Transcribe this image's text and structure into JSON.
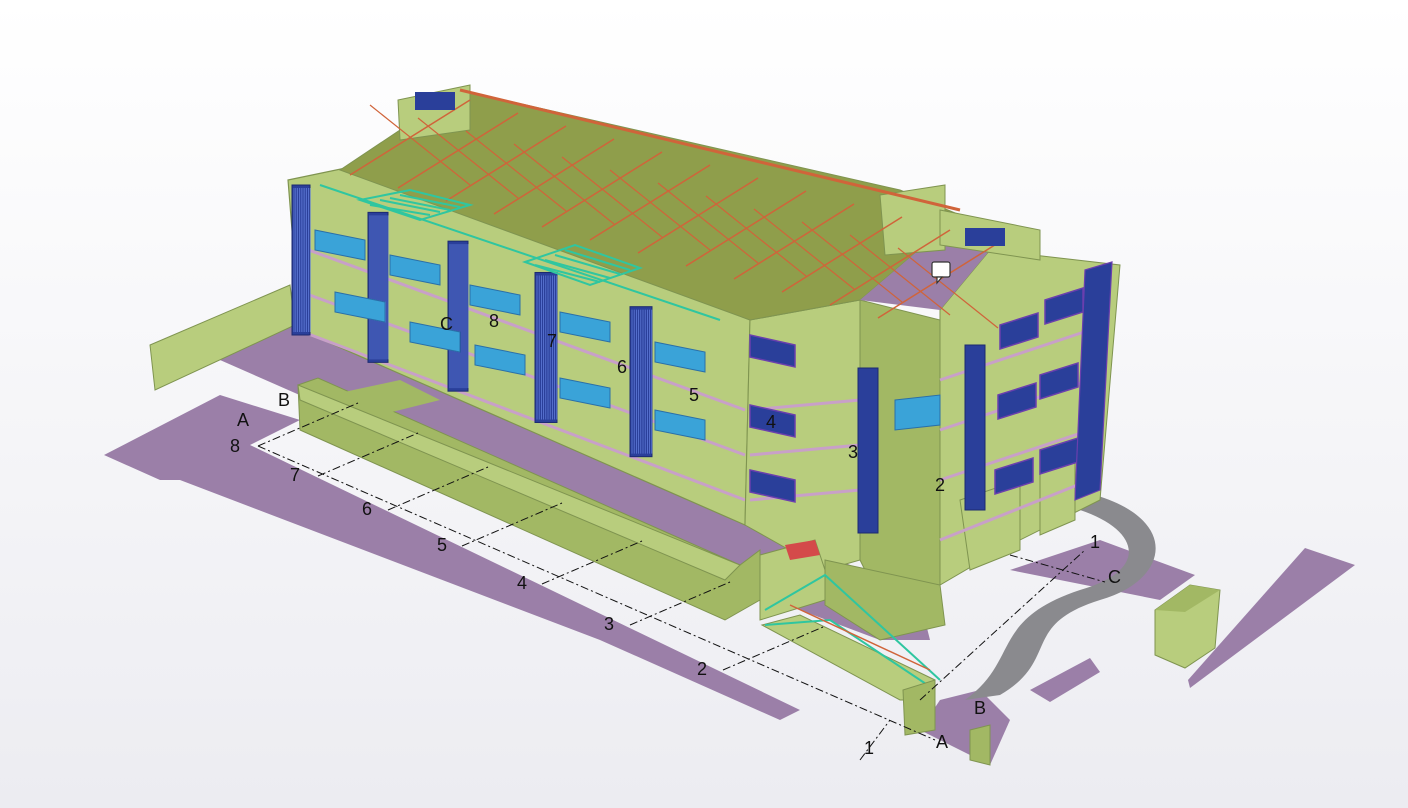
{
  "colors": {
    "background": "#f4f4f7",
    "slab": "#9b7fa8",
    "wall": "#b8cd7d",
    "wall_dark": "#a2b864",
    "wall_edge": "#7f9450",
    "roof": "#8f9e4b",
    "rafter": "#d0643a",
    "glass": "#3aa3d8",
    "window_frame": "#2a3f9a",
    "railing": "#2fc6a0",
    "path": "#8a8a8e"
  },
  "grid_labels": {
    "front_axis": [
      "8",
      "7",
      "6",
      "5",
      "4",
      "3",
      "2",
      "1"
    ],
    "side_axis": [
      "A",
      "B",
      "C"
    ],
    "facade_numbers": [
      "8",
      "7",
      "6",
      "5",
      "4",
      "3",
      "2"
    ],
    "facade_letter": "C",
    "right_axis_number": "1",
    "right_axis_letter": "C",
    "bottom_letters": [
      "B",
      "A"
    ],
    "left_letters": [
      "A",
      "B"
    ]
  },
  "comment_icon": "speech-bubble-icon"
}
